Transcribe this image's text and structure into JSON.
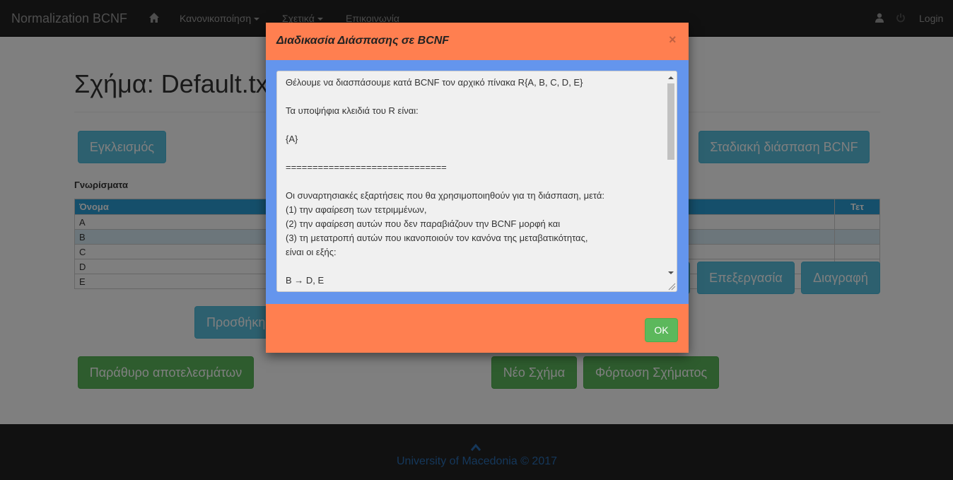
{
  "navbar": {
    "brand": "Normalization BCNF",
    "menu_normalization": "Κανονικοποίηση",
    "menu_about": "Σχετικά",
    "menu_contact": "Επικοινωνία",
    "login": "Login",
    "icons": [
      "home-icon",
      "user-icon",
      "power-icon"
    ]
  },
  "page": {
    "title": "Σχήμα: Default.txt",
    "closure_button": "Εγκλεισμός",
    "stepwise_button": "Σταδιακή διάσπαση BCNF",
    "attributes_label": "Γνωρίσματα",
    "table_headers": {
      "name": "Όνομα",
      "right": "Τετ"
    },
    "attributes": [
      "A",
      "B",
      "C",
      "D",
      "E"
    ],
    "add_button": "Προσθήκη",
    "edit_button": "Επεξεργασία",
    "delete_button": "Διαγραφή",
    "results_button": "Παράθυρο αποτελεσμάτων",
    "new_schema_button": "Νέο Σχήμα",
    "load_schema_button": "Φόρτωση Σχήματος"
  },
  "footer": {
    "text": "University of Macedonia © 2017"
  },
  "modal": {
    "title": "Διαδικασία Διάσπασης σε BCNF",
    "close": "×",
    "ok": "OK",
    "lines": [
      "Θέλουμε να διασπάσουμε κατά BCNF τον αρχικό πίνακα R{A, B, C, D, E}",
      "",
      "Τα υποψήφια κλειδιά του R είναι:",
      "",
      "{A}",
      "",
      "==============================",
      "",
      "Οι συναρτησιακές εξαρτήσεις που θα χρησιμοποιηθούν για τη διάσπαση, μετά:",
      "(1) την αφαίρεση των τετριμμένων,",
      "(2) την αφαίρεση αυτών που δεν παραβιάζουν την BCNF μορφή και",
      "(3) τη μετατροπή αυτών που ικανοποιούν τον κανόνα της μεταβατικότητας,",
      "είναι οι εξής:",
      "",
      "B → D, E"
    ]
  },
  "colors": {
    "modal_bg": "#ff7f50",
    "modal_body_bg": "#6495ed",
    "info": "#5bc0de",
    "success": "#5cb85c",
    "navbar": "#222222"
  }
}
